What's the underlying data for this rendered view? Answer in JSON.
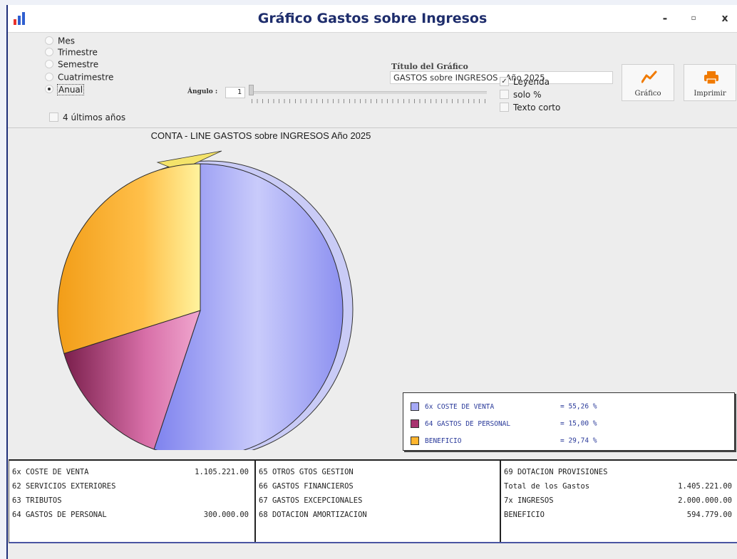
{
  "window": {
    "title": "Gráfico Gastos sobre Ingresos",
    "min_glyph": "-",
    "max_glyph": "▫",
    "close_glyph": "x"
  },
  "colors": {
    "title": "#1e2d6c",
    "accent": "#f07a00",
    "slice_coste": "#9fa3f5",
    "slice_personal": "#a0306c",
    "slice_beneficio": "#ffb234"
  },
  "periods": [
    {
      "label": "Mes",
      "checked": false
    },
    {
      "label": "Trimestre",
      "checked": false
    },
    {
      "label": "Semestre",
      "checked": false
    },
    {
      "label": "Cuatrimestre",
      "checked": false
    },
    {
      "label": "Anual",
      "checked": true
    }
  ],
  "last4": {
    "label": "4 últimos años",
    "checked": false
  },
  "angle": {
    "label": "Ángulo :",
    "value": "1"
  },
  "title_field": {
    "label": "Título del Gráfico",
    "value": "GASTOS sobre INGRESOS   Año 2025"
  },
  "options": [
    {
      "label": "Leyenda",
      "checked": true
    },
    {
      "label": "solo %",
      "checked": false
    },
    {
      "label": "Texto corto",
      "checked": false
    }
  ],
  "buttons": {
    "grafico": "Gráfico",
    "imprimir": "Imprimir",
    "grafico_icon": "line-chart-icon",
    "imprimir_icon": "printer-icon"
  },
  "chart_data": {
    "type": "pie",
    "title": "CONTA - LINE GASTOS sobre INGRESOS   Año 2025",
    "categories": [
      "6x COSTE DE VENTA",
      "64 GASTOS DE PERSONAL",
      "BENEFICIO"
    ],
    "values": [
      55.26,
      15.0,
      29.74
    ],
    "value_labels": [
      "= 55,26 %",
      "= 15,00 %",
      "= 29,74 %"
    ],
    "colors": [
      "#a6a9f6",
      "#a8336f",
      "#ffb52e"
    ],
    "legend": "right"
  },
  "summary": {
    "col1": [
      {
        "label": "6x COSTE DE VENTA",
        "value": "1.105.221.00"
      },
      {
        "label": "62 SERVICIOS EXTERIORES",
        "value": ""
      },
      {
        "label": "63 TRIBUTOS",
        "value": ""
      },
      {
        "label": "64 GASTOS DE PERSONAL",
        "value": "300.000.00"
      }
    ],
    "col2": [
      {
        "label": "65 OTROS GTOS GESTION",
        "value": ""
      },
      {
        "label": "66 GASTOS FINANCIEROS",
        "value": ""
      },
      {
        "label": "67 GASTOS EXCEPCIONALES",
        "value": ""
      },
      {
        "label": "68 DOTACION AMORTIZACION",
        "value": ""
      }
    ],
    "col3": [
      {
        "label": "69 DOTACION PROVISIONES",
        "value": ""
      },
      {
        "label": "Total de los Gastos",
        "value": "1.405.221.00"
      },
      {
        "label": "7x INGRESOS",
        "value": "2.000.000.00"
      },
      {
        "label": "BENEFICIO",
        "value": "594.779.00"
      }
    ]
  }
}
